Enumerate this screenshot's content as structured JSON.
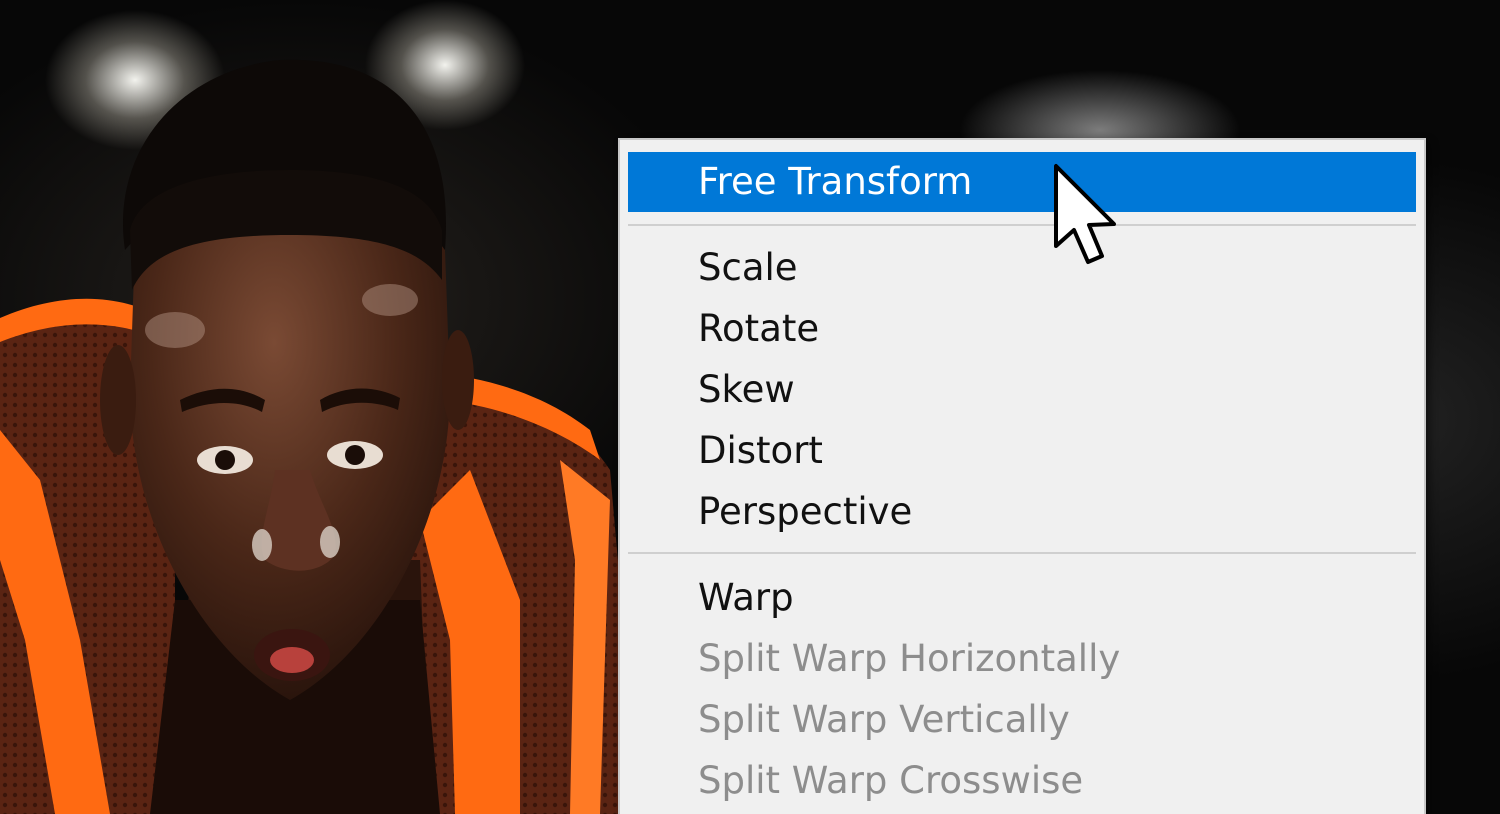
{
  "context_menu": {
    "items": [
      {
        "label": "Free Transform",
        "state": "highlighted"
      },
      {
        "label": "Scale",
        "state": "enabled"
      },
      {
        "label": "Rotate",
        "state": "enabled"
      },
      {
        "label": "Skew",
        "state": "enabled"
      },
      {
        "label": "Distort",
        "state": "enabled"
      },
      {
        "label": "Perspective",
        "state": "enabled"
      },
      {
        "label": "Warp",
        "state": "enabled"
      },
      {
        "label": "Split Warp Horizontally",
        "state": "disabled"
      },
      {
        "label": "Split Warp Vertically",
        "state": "disabled"
      },
      {
        "label": "Split Warp Crosswise",
        "state": "disabled"
      }
    ]
  },
  "colors": {
    "menu_background": "#f0f0f0",
    "highlight": "#0078d7",
    "highlight_text": "#ffffff",
    "enabled_text": "#111111",
    "disabled_text": "#8d8d8d",
    "jersey_orange": "#ff6a12"
  },
  "icons": {
    "cursor": "arrow-pointer-icon"
  }
}
